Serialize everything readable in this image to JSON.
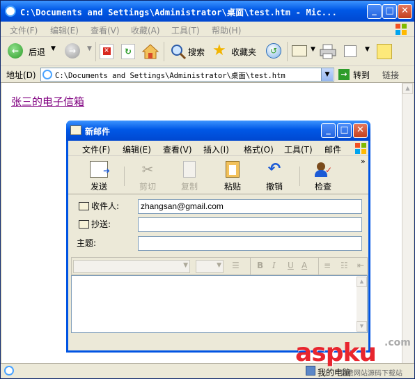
{
  "ie": {
    "title": "C:\\Documents and Settings\\Administrator\\桌面\\test.htm - Mic...",
    "menu": [
      "文件(F)",
      "编辑(E)",
      "查看(V)",
      "收藏(A)",
      "工具(T)",
      "帮助(H)"
    ],
    "toolbar": {
      "back_label": "后退",
      "search_label": "搜索",
      "favorites_label": "收藏夹"
    },
    "address": {
      "label": "地址(D)",
      "value": "C:\\Documents and Settings\\Administrator\\桌面\\test.htm",
      "go_label": "转到",
      "links_label": "链接"
    },
    "content": {
      "link_text": "张三的电子信箱"
    },
    "status": {
      "zone_label": "我的电脑"
    }
  },
  "mail": {
    "title": "新邮件",
    "menu": [
      "文件(F)",
      "编辑(E)",
      "查看(V)",
      "插入(I)",
      "格式(O)",
      "工具(T)",
      "邮件"
    ],
    "toolbar": [
      "发送",
      "剪切",
      "复制",
      "粘贴",
      "撤销",
      "检查"
    ],
    "fields": {
      "to_label": "收件人:",
      "to_value": "zhangsan@gmail.com",
      "cc_label": "抄送:",
      "cc_value": "",
      "subject_label": "主题:",
      "subject_value": ""
    },
    "format_buttons": [
      "B",
      "I",
      "U",
      "A"
    ]
  },
  "watermark": {
    "brand": "aspku",
    "suffix": ".com",
    "tagline": "免费网站源码下载站"
  },
  "colors": {
    "xp_title_blue": "#0058e6",
    "window_face": "#ece9d8",
    "link_visited": "#800080",
    "watermark_red": "#e8262e"
  }
}
